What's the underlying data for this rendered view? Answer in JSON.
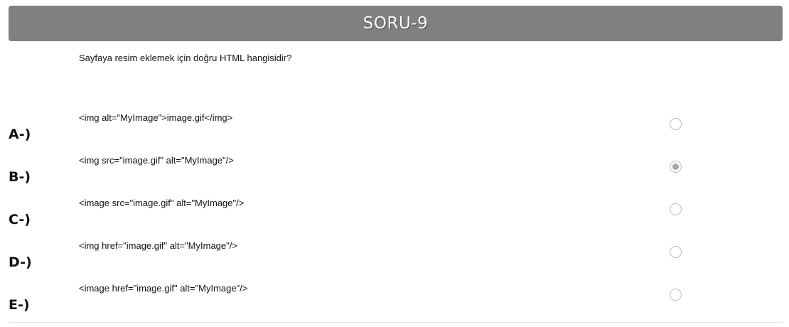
{
  "header": {
    "title": "SORU-9",
    "color": "#808080"
  },
  "question": {
    "text": "Sayfaya resim eklemek için doğru HTML hangisidir?"
  },
  "options": [
    {
      "letter": "A-)",
      "text": "<img alt=\"MyImage\">image.gif</img>",
      "checked": false
    },
    {
      "letter": "B-)",
      "text": "<img src=\"image.gif\" alt=\"MyImage\"/>",
      "checked": true
    },
    {
      "letter": "C-)",
      "text": "<image src=\"image.gif\" alt=\"MyImage\"/>",
      "checked": false
    },
    {
      "letter": "D-)",
      "text": "<img href=\"image.gif\" alt=\"MyImage\"/>",
      "checked": false
    },
    {
      "letter": "E-)",
      "text": "<image href=\"image.gif\" alt=\"MyImage\"/>",
      "checked": false
    }
  ]
}
